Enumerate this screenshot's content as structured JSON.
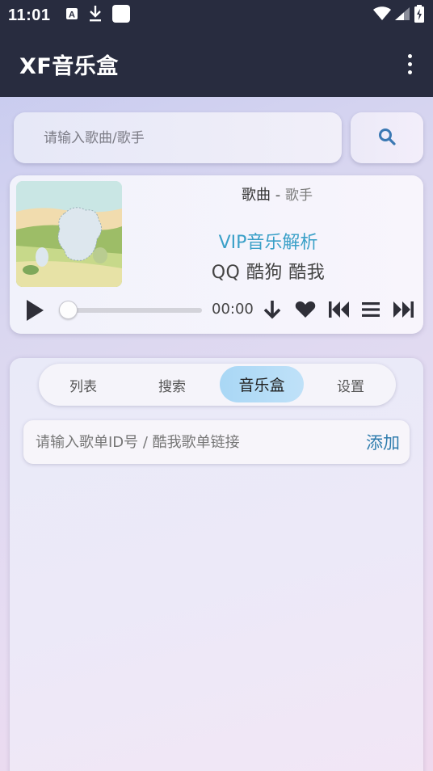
{
  "status_bar": {
    "time": "11:01",
    "notification_icons": [
      "text-icon",
      "download-icon",
      "square-icon"
    ],
    "system_icons": [
      "wifi-icon",
      "signal-icon",
      "battery-charging-icon"
    ]
  },
  "app_bar": {
    "title": "XF音乐盒",
    "menu_icon": "more-vert-icon"
  },
  "search": {
    "placeholder": "请输入歌曲/歌手",
    "button_icon": "search-icon"
  },
  "player": {
    "song_name": "歌曲",
    "separator": " - ",
    "artist": "歌手",
    "vip_text": "VIP音乐解析",
    "sources": "QQ 酷狗 酷我",
    "time": "00:00",
    "progress": 0,
    "controls": [
      "play-icon",
      "download-icon",
      "heart-icon",
      "previous-icon",
      "playlist-icon",
      "next-icon"
    ]
  },
  "tabs": {
    "items": [
      {
        "label": "列表"
      },
      {
        "label": "搜索"
      },
      {
        "label": "音乐盒"
      },
      {
        "label": "设置"
      }
    ],
    "active_index": 2
  },
  "playlist_import": {
    "placeholder": "请输入歌单ID号 / 酷我歌单链接",
    "add_label": "添加"
  },
  "colors": {
    "app_bar": "#282c3f",
    "accent_text": "#3aa0c8",
    "active_tab": "#b3dcf6",
    "add_button": "#2f7cad"
  }
}
